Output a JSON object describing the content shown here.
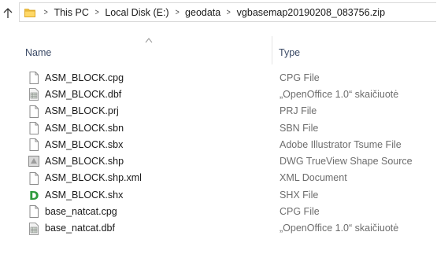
{
  "address": {
    "crumbs": [
      "This PC",
      "Local Disk (E:)",
      "geodata",
      "vgbasemap20190208_083756.zip"
    ]
  },
  "columns": {
    "name": "Name",
    "type": "Type"
  },
  "files": [
    {
      "name": "ASM_BLOCK.cpg",
      "type": "CPG File",
      "icon": "blank-file-icon"
    },
    {
      "name": "ASM_BLOCK.dbf",
      "type": "„OpenOffice 1.0“ skaičiuotė",
      "icon": "spreadsheet-file-icon"
    },
    {
      "name": "ASM_BLOCK.prj",
      "type": "PRJ File",
      "icon": "blank-file-icon"
    },
    {
      "name": "ASM_BLOCK.sbn",
      "type": "SBN File",
      "icon": "blank-file-icon"
    },
    {
      "name": "ASM_BLOCK.sbx",
      "type": "Adobe Illustrator Tsume File",
      "icon": "blank-file-icon"
    },
    {
      "name": "ASM_BLOCK.shp",
      "type": "DWG TrueView Shape Source",
      "icon": "dwg-file-icon"
    },
    {
      "name": "ASM_BLOCK.shp.xml",
      "type": "XML Document",
      "icon": "blank-file-icon"
    },
    {
      "name": "ASM_BLOCK.shx",
      "type": "SHX File",
      "icon": "green-d-file-icon"
    },
    {
      "name": "base_natcat.cpg",
      "type": "CPG File",
      "icon": "blank-file-icon"
    },
    {
      "name": "base_natcat.dbf",
      "type": "„OpenOffice 1.0“ skaičiuotė",
      "icon": "spreadsheet-file-icon"
    }
  ]
}
